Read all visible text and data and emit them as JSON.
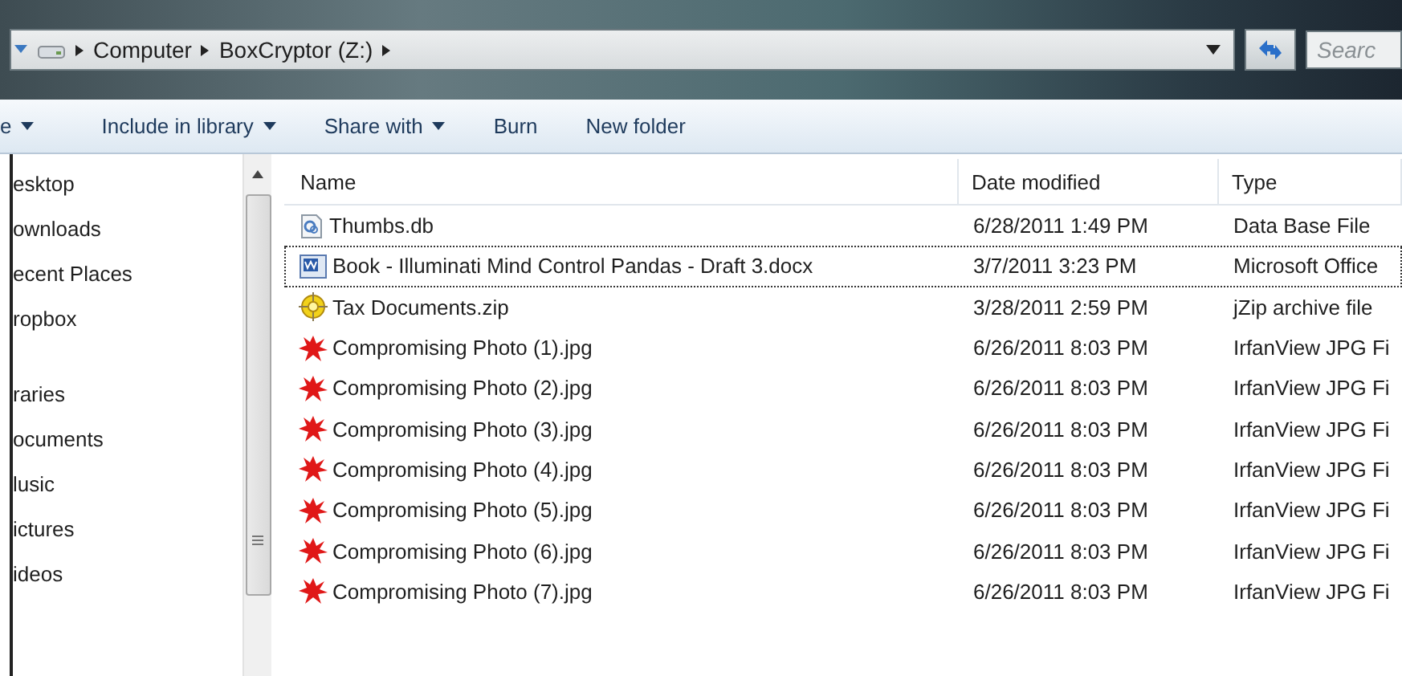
{
  "address_bar": {
    "breadcrumbs": [
      "Computer",
      "BoxCryptor (Z:)"
    ],
    "search": {
      "placeholder": "Searc"
    }
  },
  "toolbar": [
    {
      "label": "e",
      "has_menu": true
    },
    {
      "label": "Include in library",
      "has_menu": true
    },
    {
      "label": "Share with",
      "has_menu": true
    },
    {
      "label": "Burn",
      "has_menu": false
    },
    {
      "label": "New folder",
      "has_menu": false
    }
  ],
  "sidebar": {
    "groups": [
      {
        "items": [
          "esktop",
          "ownloads",
          "ecent Places",
          "ropbox"
        ]
      },
      {
        "items": [
          "raries",
          "ocuments",
          "lusic",
          "ictures",
          "ideos"
        ]
      }
    ]
  },
  "table": {
    "columns": [
      "Name",
      "Date modified",
      "Type"
    ],
    "rows": [
      {
        "kind": "database",
        "name": "Thumbs.db",
        "date": "6/28/2011 1:49 PM",
        "type": "Data Base File",
        "focused": false
      },
      {
        "kind": "document",
        "name": "Book - Illuminati Mind Control Pandas - Draft 3.docx",
        "date": "3/7/2011 3:23 PM",
        "type": "Microsoft Office",
        "focused": true
      },
      {
        "kind": "archive",
        "name": "Tax Documents.zip",
        "date": "3/28/2011 2:59 PM",
        "type": "jZip archive file",
        "focused": false
      },
      {
        "kind": "image",
        "name": "Compromising Photo (1).jpg",
        "date": "6/26/2011 8:03 PM",
        "type": "IrfanView JPG Fi",
        "focused": false
      },
      {
        "kind": "image",
        "name": "Compromising Photo (2).jpg",
        "date": "6/26/2011 8:03 PM",
        "type": "IrfanView JPG Fi",
        "focused": false
      },
      {
        "kind": "image",
        "name": "Compromising Photo (3).jpg",
        "date": "6/26/2011 8:03 PM",
        "type": "IrfanView JPG Fi",
        "focused": false
      },
      {
        "kind": "image",
        "name": "Compromising Photo (4).jpg",
        "date": "6/26/2011 8:03 PM",
        "type": "IrfanView JPG Fi",
        "focused": false
      },
      {
        "kind": "image",
        "name": "Compromising Photo (5).jpg",
        "date": "6/26/2011 8:03 PM",
        "type": "IrfanView JPG Fi",
        "focused": false
      },
      {
        "kind": "image",
        "name": "Compromising Photo (6).jpg",
        "date": "6/26/2011 8:03 PM",
        "type": "IrfanView JPG Fi",
        "focused": false
      },
      {
        "kind": "image",
        "name": "Compromising Photo (7).jpg",
        "date": "6/26/2011 8:03 PM",
        "type": "IrfanView JPG Fi",
        "focused": false
      }
    ]
  }
}
